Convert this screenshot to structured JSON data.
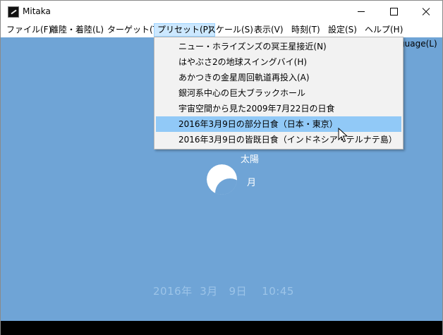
{
  "window": {
    "title": "Mitaka",
    "controls": [
      "minimize-icon",
      "maximize-icon",
      "close-icon"
    ]
  },
  "menubar": {
    "items": [
      {
        "label": "ファイル(F)"
      },
      {
        "label": "離陸・着陸(L)"
      },
      {
        "label": "ターゲット(T)"
      },
      {
        "label": "プリセット(P)",
        "active": true
      },
      {
        "label": "スケール(S)"
      },
      {
        "label": "表示(V)"
      },
      {
        "label": "時刻(T)"
      },
      {
        "label": "設定(S)"
      },
      {
        "label": "ヘルプ(H)"
      }
    ],
    "language_partial": "guage(L)"
  },
  "preset_menu": {
    "items": [
      {
        "label": "ニュー・ホライズンズの冥王星接近(N)"
      },
      {
        "label": "はやぶさ2の地球スイングバイ(H)"
      },
      {
        "label": "あかつきの金星周回軌道再投入(A)"
      },
      {
        "label": "銀河系中心の巨大ブラックホール"
      },
      {
        "label": "宇宙空間から見た2009年7月22日の日食"
      },
      {
        "label": "2016年3月9日の部分日食（日本・東京）",
        "highlighted": true
      },
      {
        "label": "2016年3月9日の皆既日食（インドネシア・テルナテ島）"
      }
    ]
  },
  "scene": {
    "sun_label": "太陽",
    "moon_label": "月",
    "datetime": "2016年  3月   9日    10:45",
    "colors": {
      "sky": "#6fa4d6",
      "menu_highlight": "#91c9f7",
      "active_menu": "#cce8ff"
    }
  }
}
